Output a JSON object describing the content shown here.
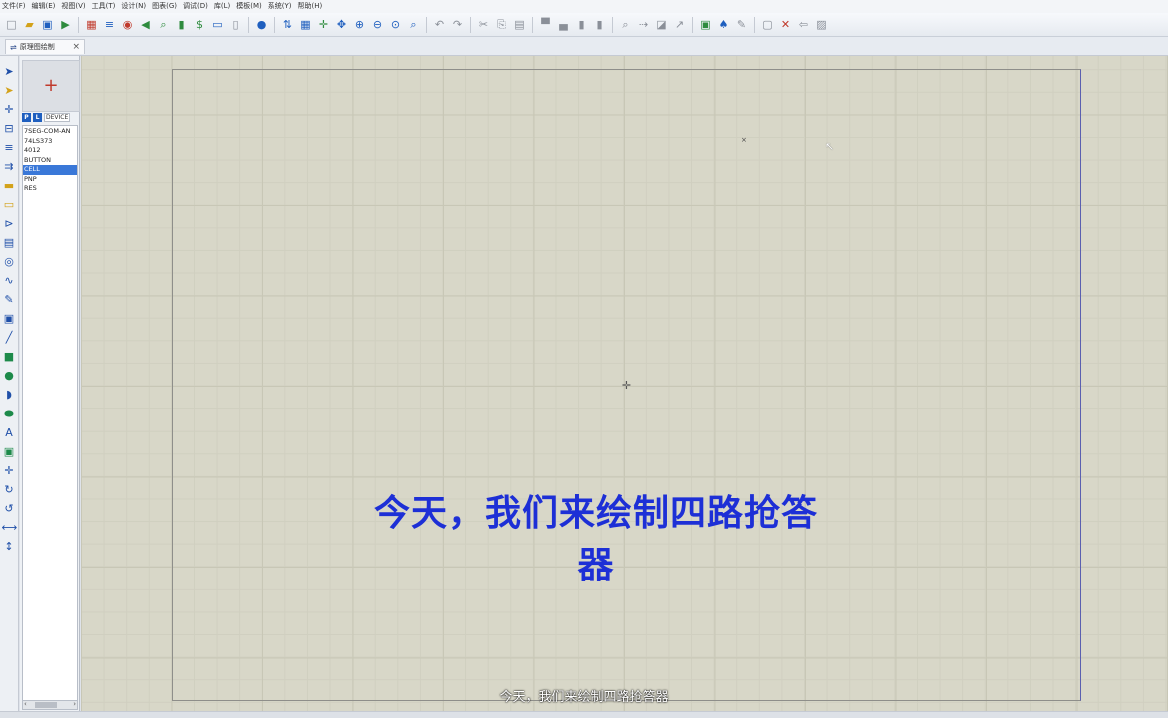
{
  "menu": [
    "文件(F)",
    "编辑(E)",
    "视图(V)",
    "工具(T)",
    "设计(N)",
    "图表(G)",
    "调试(D)",
    "库(L)",
    "模板(M)",
    "系统(Y)",
    "帮助(H)"
  ],
  "toolbar_icons": [
    {
      "name": "new-file-icon",
      "glyph": "□",
      "tone": "gray"
    },
    {
      "name": "open-folder-icon",
      "glyph": "▰",
      "tone": "yellow"
    },
    {
      "name": "save-icon",
      "glyph": "▣",
      "tone": "blue"
    },
    {
      "name": "import-icon",
      "glyph": "▶",
      "tone": "green"
    },
    {
      "name": "sep"
    },
    {
      "name": "print-icon",
      "glyph": "▦",
      "tone": "red"
    },
    {
      "name": "schematic-icon",
      "glyph": "≡",
      "tone": "blue"
    },
    {
      "name": "record-icon",
      "glyph": "◉",
      "tone": "red"
    },
    {
      "name": "step-back-icon",
      "glyph": "◀",
      "tone": "green"
    },
    {
      "name": "search-icon",
      "glyph": "⌕",
      "tone": "green"
    },
    {
      "name": "component-icon",
      "glyph": "▮",
      "tone": "green"
    },
    {
      "name": "dollar-icon",
      "glyph": "$",
      "tone": "green"
    },
    {
      "name": "netlist-icon",
      "glyph": "▭",
      "tone": "blue"
    },
    {
      "name": "doc-icon",
      "glyph": "▯",
      "tone": "gray"
    },
    {
      "name": "sep"
    },
    {
      "name": "help-icon",
      "glyph": "●",
      "tone": "blue"
    },
    {
      "name": "sep"
    },
    {
      "name": "refresh-icon",
      "glyph": "⇅",
      "tone": "blue"
    },
    {
      "name": "grid-icon",
      "glyph": "▦",
      "tone": "blue"
    },
    {
      "name": "origin-icon",
      "glyph": "✛",
      "tone": "green"
    },
    {
      "name": "pan-icon",
      "glyph": "✥",
      "tone": "blue"
    },
    {
      "name": "zoom-in-icon",
      "glyph": "⊕",
      "tone": "blue"
    },
    {
      "name": "zoom-out-icon",
      "glyph": "⊖",
      "tone": "blue"
    },
    {
      "name": "zoom-all-icon",
      "glyph": "⊙",
      "tone": "blue"
    },
    {
      "name": "zoom-area-icon",
      "glyph": "⌕",
      "tone": "blue"
    },
    {
      "name": "sep"
    },
    {
      "name": "undo-icon",
      "glyph": "↶",
      "tone": "gray"
    },
    {
      "name": "redo-icon",
      "glyph": "↷",
      "tone": "gray"
    },
    {
      "name": "sep"
    },
    {
      "name": "cut-icon",
      "glyph": "✂",
      "tone": "gray"
    },
    {
      "name": "copy-icon",
      "glyph": "⎘",
      "tone": "gray"
    },
    {
      "name": "paste-icon",
      "glyph": "▤",
      "tone": "gray"
    },
    {
      "name": "sep"
    },
    {
      "name": "block-copy-icon",
      "glyph": "▀",
      "tone": "gray"
    },
    {
      "name": "block-move-icon",
      "glyph": "▄",
      "tone": "gray"
    },
    {
      "name": "block-rotate-icon",
      "glyph": "▮",
      "tone": "gray"
    },
    {
      "name": "block-delete-icon",
      "glyph": "▮",
      "tone": "gray"
    },
    {
      "name": "sep"
    },
    {
      "name": "pick-device-icon",
      "glyph": "⌕",
      "tone": "gray"
    },
    {
      "name": "make-device-icon",
      "glyph": "⇢",
      "tone": "gray"
    },
    {
      "name": "package-tool-icon",
      "glyph": "◪",
      "tone": "gray"
    },
    {
      "name": "decompose-icon",
      "glyph": "↗",
      "tone": "gray"
    },
    {
      "name": "sep"
    },
    {
      "name": "wire-autorouter-icon",
      "glyph": "▣",
      "tone": "green"
    },
    {
      "name": "search-tag-icon",
      "glyph": "♠",
      "tone": "blue"
    },
    {
      "name": "property-tool-icon",
      "glyph": "✎",
      "tone": "gray"
    },
    {
      "name": "sep"
    },
    {
      "name": "new-sheet-icon",
      "glyph": "▢",
      "tone": "gray"
    },
    {
      "name": "remove-sheet-icon",
      "glyph": "✕",
      "tone": "red"
    },
    {
      "name": "exit-sheet-icon",
      "glyph": "⇦",
      "tone": "gray"
    },
    {
      "name": "bom-icon",
      "glyph": "▨",
      "tone": "gray"
    }
  ],
  "document_tab": {
    "label": "原理图绘制",
    "close": "×"
  },
  "tool_strip_icons": [
    {
      "name": "select-arrow-icon",
      "glyph": "➤",
      "tone": ""
    },
    {
      "name": "component-mode-icon",
      "glyph": "➤",
      "tone": "yellow"
    },
    {
      "name": "junction-icon",
      "glyph": "✛",
      "tone": ""
    },
    {
      "name": "label-icon",
      "glyph": "⊟",
      "tone": ""
    },
    {
      "name": "text-script-icon",
      "glyph": "≡",
      "tone": ""
    },
    {
      "name": "bus-icon",
      "glyph": "⇉",
      "tone": ""
    },
    {
      "name": "subcircuit-icon",
      "glyph": "▬",
      "tone": "yellow"
    },
    {
      "name": "terminal-icon",
      "glyph": "▭",
      "tone": "yellow"
    },
    {
      "name": "pin-icon",
      "glyph": "⊳",
      "tone": ""
    },
    {
      "name": "graph-icon",
      "glyph": "▤",
      "tone": ""
    },
    {
      "name": "tape-icon",
      "glyph": "◎",
      "tone": ""
    },
    {
      "name": "generator-icon",
      "glyph": "∿",
      "tone": ""
    },
    {
      "name": "probe-icon",
      "glyph": "✎",
      "tone": ""
    },
    {
      "name": "instrument-icon",
      "glyph": "▣",
      "tone": ""
    },
    {
      "name": "line-icon",
      "glyph": "╱",
      "tone": ""
    },
    {
      "name": "box-icon",
      "glyph": "■",
      "tone": "green"
    },
    {
      "name": "circle-icon",
      "glyph": "●",
      "tone": "green"
    },
    {
      "name": "arc-icon",
      "glyph": "◗",
      "tone": ""
    },
    {
      "name": "path-icon",
      "glyph": "⬬",
      "tone": "green"
    },
    {
      "name": "text-icon",
      "glyph": "A",
      "tone": ""
    },
    {
      "name": "symbol-icon",
      "glyph": "▣",
      "tone": "green"
    },
    {
      "name": "marker-icon",
      "glyph": "✛",
      "tone": ""
    },
    {
      "name": "rotate-cw-icon",
      "glyph": "↻",
      "tone": ""
    },
    {
      "name": "rotate-ccw-icon",
      "glyph": "↺",
      "tone": ""
    },
    {
      "name": "mirror-x-icon",
      "glyph": "⟷",
      "tone": ""
    },
    {
      "name": "mirror-y-icon",
      "glyph": "↕",
      "tone": ""
    }
  ],
  "device_panel": {
    "p_button": "P",
    "l_button": "L",
    "header_label": "DEVICE",
    "devices": [
      "7SEG-COM-AN",
      "74LS373",
      "4012",
      "BUTTON",
      "CELL",
      "PNP",
      "RES"
    ],
    "selected_index": 4
  },
  "overlay_title": "今天，我们来绘制四路抢答器",
  "subtitle": "今天，我们来绘制四路抢答器"
}
